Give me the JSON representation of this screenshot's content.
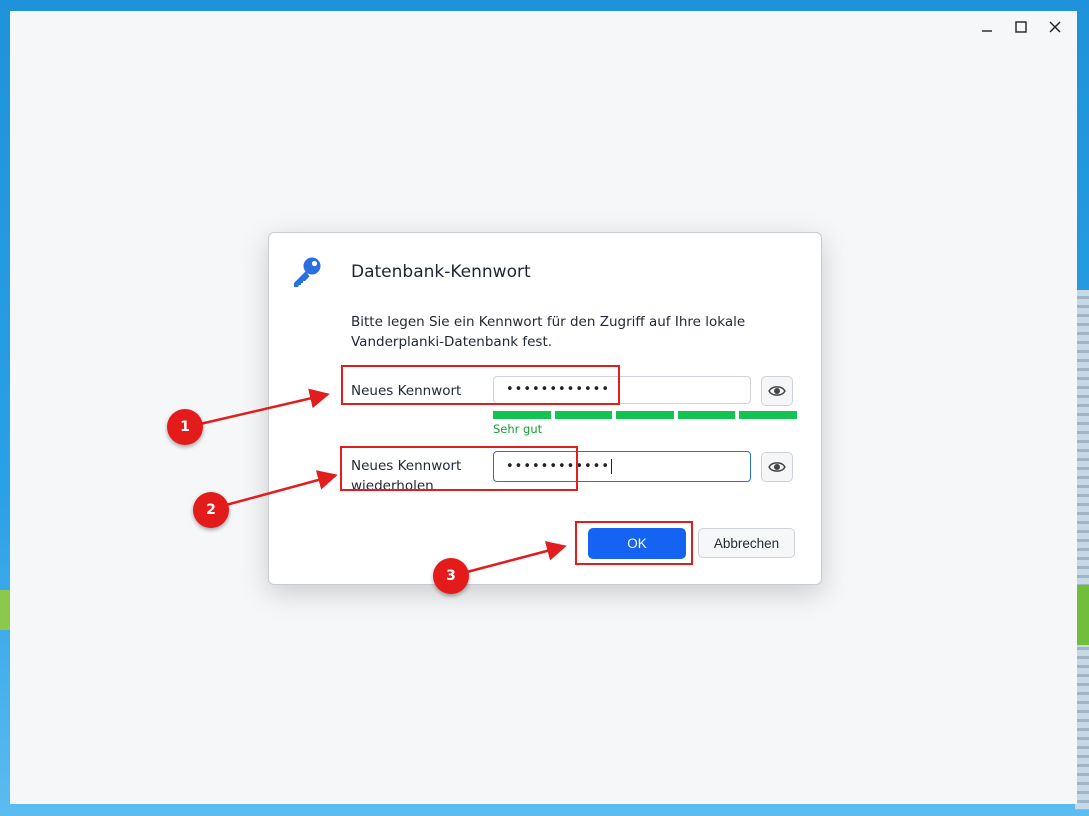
{
  "window": {
    "controls": [
      {
        "name": "minimize",
        "glyph": "—"
      },
      {
        "name": "maximize",
        "glyph": "☐"
      },
      {
        "name": "close",
        "glyph": "✕"
      }
    ]
  },
  "dialog": {
    "icon": "key-icon",
    "title": "Datenbank-Kennwort",
    "description": "Bitte legen Sie ein Kennwort für den Zugriff auf Ihre lokale Vanderplanki-Datenbank fest.",
    "new_password": {
      "label": "Neues Kennwort",
      "masked_value": "••••••••••••",
      "eye_icon": "eye-icon"
    },
    "strength": {
      "level": 5,
      "max": 5,
      "label": "Sehr gut",
      "color": "#12c452"
    },
    "repeat_password": {
      "label": "Neues Kennwort wiederholen",
      "masked_value": "••••••••••••",
      "eye_icon": "eye-icon"
    },
    "ok_label": "OK",
    "cancel_label": "Abbrechen",
    "accent": "#1463f3"
  },
  "annotations": {
    "steps": [
      "1",
      "2",
      "3"
    ],
    "color": "#e11d1d"
  }
}
